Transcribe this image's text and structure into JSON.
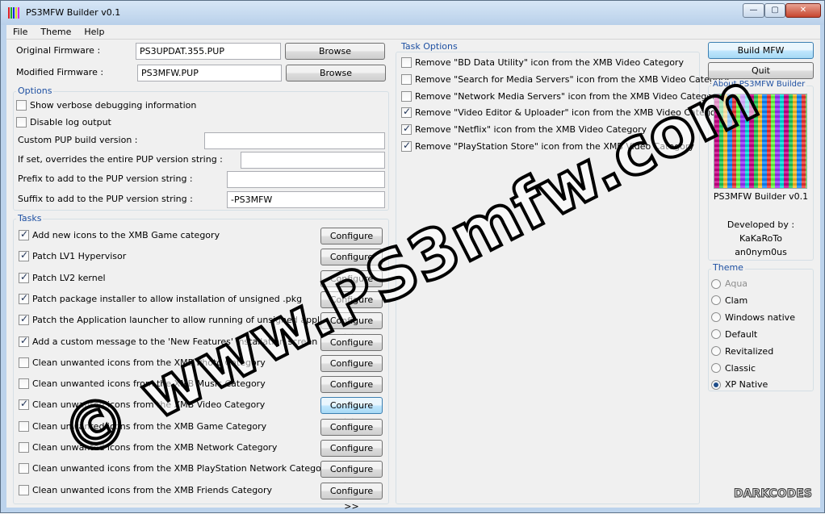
{
  "window": {
    "title": "PS3MFW Builder v0.1",
    "min_glyph": "—",
    "max_glyph": "▢",
    "close_glyph": "✕"
  },
  "menu": [
    "File",
    "Theme",
    "Help"
  ],
  "firmware": {
    "original_label": "Original Firmware :",
    "original_value": "PS3UPDAT.355.PUP",
    "modified_label": "Modified Firmware :",
    "modified_value": "PS3MFW.PUP",
    "browse_label": "Browse"
  },
  "options": {
    "title": "Options",
    "verbose": {
      "label": "Show verbose debugging information",
      "checked": false
    },
    "nolog": {
      "label": "Disable log output",
      "checked": false
    },
    "custom_build_label": "Custom PUP build version :",
    "override_label": "If set, overrides the entire PUP version string :",
    "prefix_label": "Prefix to add to the PUP version string :",
    "suffix_label": "Suffix to add to the PUP version string :",
    "suffix_value": "-PS3MFW"
  },
  "tasks": {
    "title": "Tasks",
    "configure_label": "Configure >>",
    "items": [
      {
        "label": "Add new icons to the XMB Game category",
        "checked": true
      },
      {
        "label": "Patch LV1 Hypervisor",
        "checked": true
      },
      {
        "label": "Patch LV2 kernel",
        "checked": true
      },
      {
        "label": "Patch package installer to allow installation of unsigned .pkg",
        "checked": true
      },
      {
        "label": "Patch the Application launcher to allow running of unsigned application",
        "checked": true
      },
      {
        "label": "Add a custom message to the 'New Features' installation screen",
        "checked": true
      },
      {
        "label": "Clean unwanted icons from the XMB Photo Category",
        "checked": false
      },
      {
        "label": "Clean unwanted icons from the XMB Music Category",
        "checked": false
      },
      {
        "label": "Clean unwanted icons from the XMB Video Category",
        "checked": true
      },
      {
        "label": "Clean unwanted icons from the XMB Game Category",
        "checked": false
      },
      {
        "label": "Clean unwanted icons from the XMB Network Category",
        "checked": false
      },
      {
        "label": "Clean unwanted icons from the XMB PlayStation Network Category",
        "checked": false
      },
      {
        "label": "Clean unwanted icons from the XMB Friends Category",
        "checked": false
      }
    ]
  },
  "task_options": {
    "title": "Task Options",
    "items": [
      {
        "label": "Remove \"BD Data Utility\" icon from the XMB Video Category",
        "checked": false
      },
      {
        "label": "Remove \"Search for Media Servers\" icon from the XMB Video Category",
        "checked": false
      },
      {
        "label": "Remove \"Network Media Servers\" icon from the XMB Video Category",
        "checked": false
      },
      {
        "label": "Remove \"Video Editor & Uploader\" icon from the XMB Video Category",
        "checked": true
      },
      {
        "label": "Remove \"Netflix\" icon from the XMB Video Category",
        "checked": true
      },
      {
        "label": "Remove \"PlayStation Store\" icon from the XMB Video Category",
        "checked": true
      }
    ]
  },
  "side": {
    "build_label": "Build MFW",
    "quit_label": "Quit",
    "about_title": "About PS3MFW Builder",
    "app_name": "PS3MFW Builder v0.1",
    "developed_by": "Developed by :",
    "dev1": "KaKaRoTo",
    "dev2": "an0nym0us"
  },
  "theme": {
    "title": "Theme",
    "items": [
      {
        "label": "Aqua",
        "selected": false,
        "disabled": true
      },
      {
        "label": "Clam",
        "selected": false,
        "disabled": false
      },
      {
        "label": "Windows native",
        "selected": false,
        "disabled": false
      },
      {
        "label": "Default",
        "selected": false,
        "disabled": false
      },
      {
        "label": "Revitalized",
        "selected": false,
        "disabled": false
      },
      {
        "label": "Classic",
        "selected": false,
        "disabled": false
      },
      {
        "label": "XP Native",
        "selected": true,
        "disabled": false
      }
    ]
  },
  "watermark": {
    "text": "© www.PS3mfw.com",
    "corner_logo": "DARKCODES"
  }
}
